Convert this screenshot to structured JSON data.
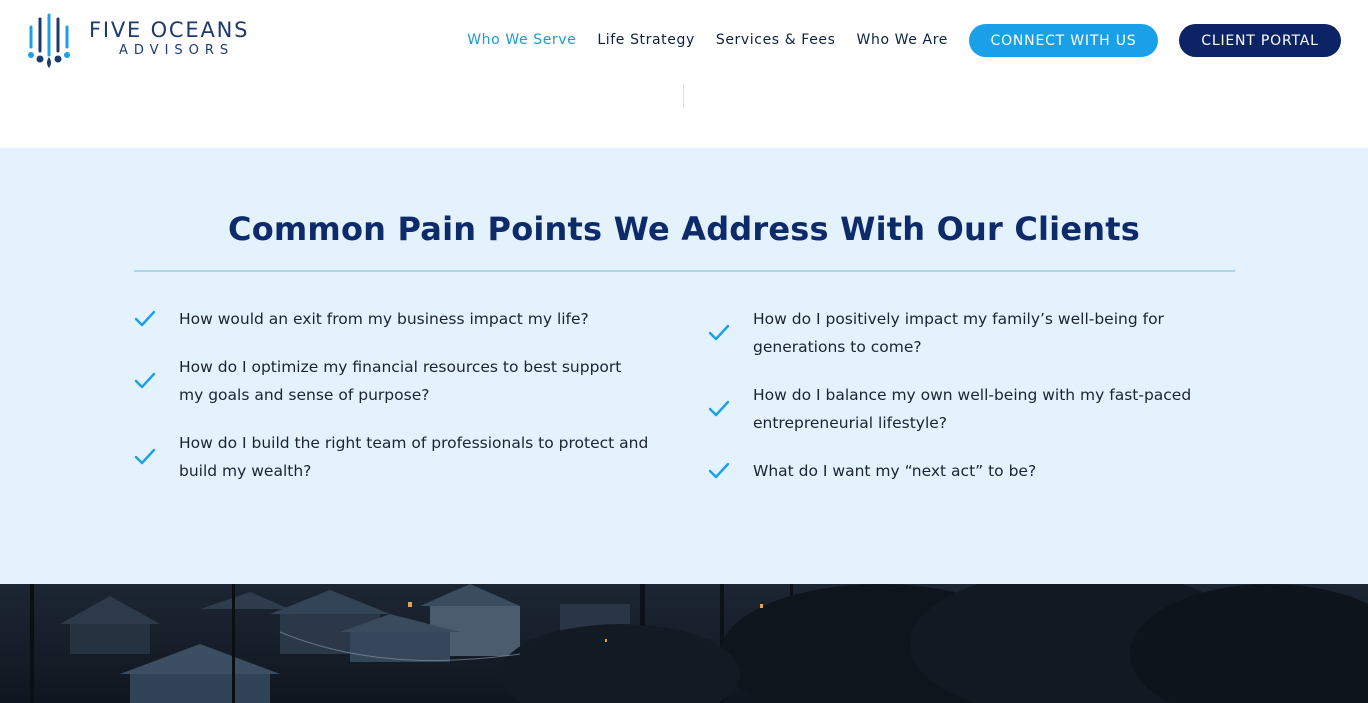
{
  "header": {
    "logo": {
      "line1": "FIVE OCEANS",
      "line2": "ADVISORS"
    },
    "nav": [
      {
        "label": "Who We Serve",
        "active": true
      },
      {
        "label": "Life Strategy",
        "active": false
      },
      {
        "label": "Services & Fees",
        "active": false
      },
      {
        "label": "Who We Are",
        "active": false
      }
    ],
    "connect_button": "CONNECT WITH US",
    "portal_button": "CLIENT PORTAL"
  },
  "pain_points": {
    "title": "Common Pain Points We Address With Our Clients",
    "left": [
      "How would an exit from my business impact my life?",
      "How do I optimize my financial resources to best support my goals and sense of purpose?",
      "How do I build the right team of professionals to protect and build my wealth?"
    ],
    "right": [
      "How do I positively impact my family’s well-being for generations to come?",
      "How do I balance my own well-being with my fast-paced entrepreneurial lifestyle?",
      "What do I want my “next act” to be?"
    ]
  },
  "colors": {
    "accent": "#1aa0e8",
    "navy": "#0c2366",
    "section_bg": "#e3f2fc",
    "check": "#1aa0e8"
  },
  "icons": {
    "check": "check-icon",
    "logo": "water-drops-logo-icon"
  }
}
